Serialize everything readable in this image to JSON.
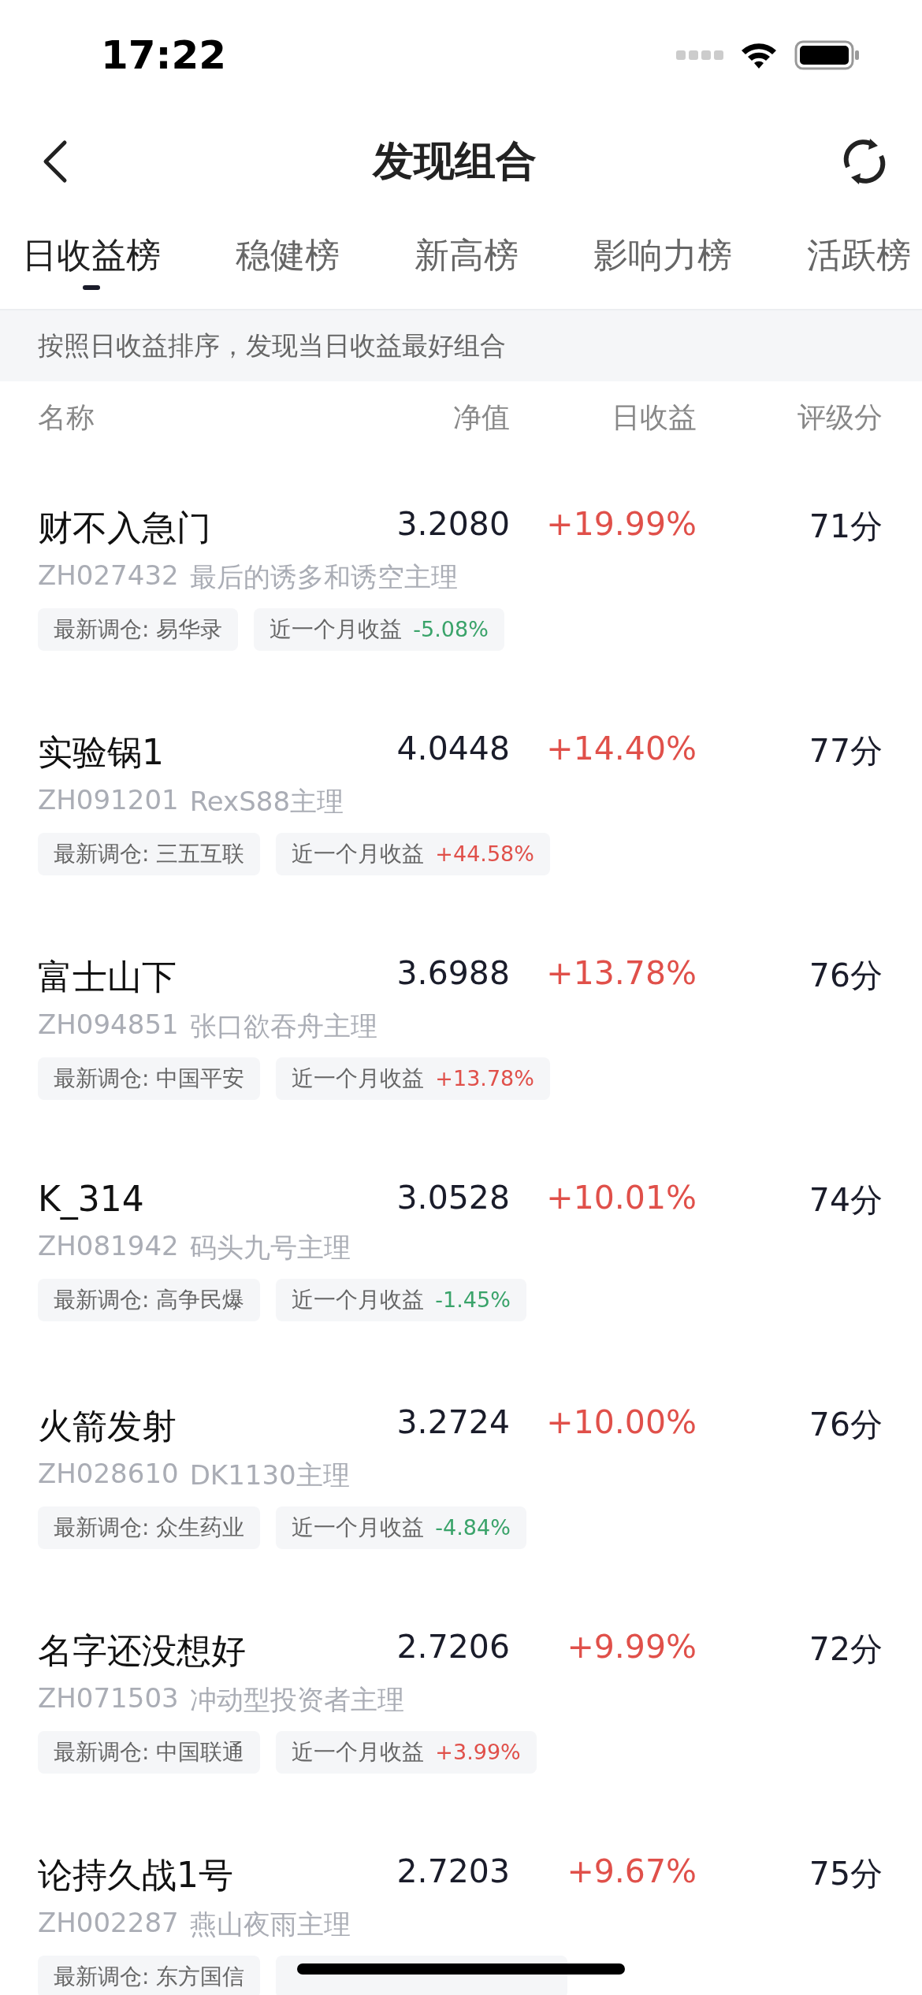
{
  "status_bar": {
    "time": "17:22"
  },
  "nav": {
    "title": "发现组合"
  },
  "tabs": [
    {
      "label": "日收益榜",
      "selected": true
    },
    {
      "label": "稳健榜",
      "selected": false
    },
    {
      "label": "新高榜",
      "selected": false
    },
    {
      "label": "影响力榜",
      "selected": false
    },
    {
      "label": "活跃榜",
      "selected": false
    }
  ],
  "banner": "按照日收益排序，发现当日收益最好组合",
  "columns": [
    "名称",
    "净值",
    "日收益",
    "评级分"
  ],
  "rows": [
    {
      "name": "财不入急门",
      "nav": "3.2080",
      "daily": {
        "text": "+19.99%",
        "color": "#e0504a"
      },
      "score": "71分",
      "code": "ZH027432",
      "manager": "最后的诱多和诱空主理",
      "rebalance": "最新调仓: 易华录",
      "month": {
        "label": "近一个月收益",
        "text": "-5.08%",
        "color": "#3aa36a"
      }
    },
    {
      "name": "实验锅1",
      "nav": "4.0448",
      "daily": {
        "text": "+14.40%",
        "color": "#e0504a"
      },
      "score": "77分",
      "code": "ZH091201",
      "manager": "RexS88主理",
      "rebalance": "最新调仓: 三五互联",
      "month": {
        "label": "近一个月收益",
        "text": "+44.58%",
        "color": "#e0504a"
      }
    },
    {
      "name": "富士山下",
      "nav": "3.6988",
      "daily": {
        "text": "+13.78%",
        "color": "#e0504a"
      },
      "score": "76分",
      "code": "ZH094851",
      "manager": "张口欲吞舟主理",
      "rebalance": "最新调仓: 中国平安",
      "month": {
        "label": "近一个月收益",
        "text": "+13.78%",
        "color": "#e0504a"
      }
    },
    {
      "name": "K_314",
      "nav": "3.0528",
      "daily": {
        "text": "+10.01%",
        "color": "#e0504a"
      },
      "score": "74分",
      "code": "ZH081942",
      "manager": "码头九号主理",
      "rebalance": "最新调仓: 高争民爆",
      "month": {
        "label": "近一个月收益",
        "text": "-1.45%",
        "color": "#3aa36a"
      }
    },
    {
      "name": "火箭发射",
      "nav": "3.2724",
      "daily": {
        "text": "+10.00%",
        "color": "#e0504a"
      },
      "score": "76分",
      "code": "ZH028610",
      "manager": "DK1130主理",
      "rebalance": "最新调仓: 众生药业",
      "month": {
        "label": "近一个月收益",
        "text": "-4.84%",
        "color": "#3aa36a"
      }
    },
    {
      "name": "名字还没想好",
      "nav": "2.7206",
      "daily": {
        "text": "+9.99%",
        "color": "#e0504a"
      },
      "score": "72分",
      "code": "ZH071503",
      "manager": "冲动型投资者主理",
      "rebalance": "最新调仓: 中国联通",
      "month": {
        "label": "近一个月收益",
        "text": "+3.99%",
        "color": "#e0504a"
      }
    },
    {
      "name": "论持久战1号",
      "nav": "2.7203",
      "daily": {
        "text": "+9.67%",
        "color": "#e0504a"
      },
      "score": "75分",
      "code": "ZH002287",
      "manager": "燕山夜雨主理",
      "rebalance": "最新调仓: 东方国信"
    }
  ]
}
